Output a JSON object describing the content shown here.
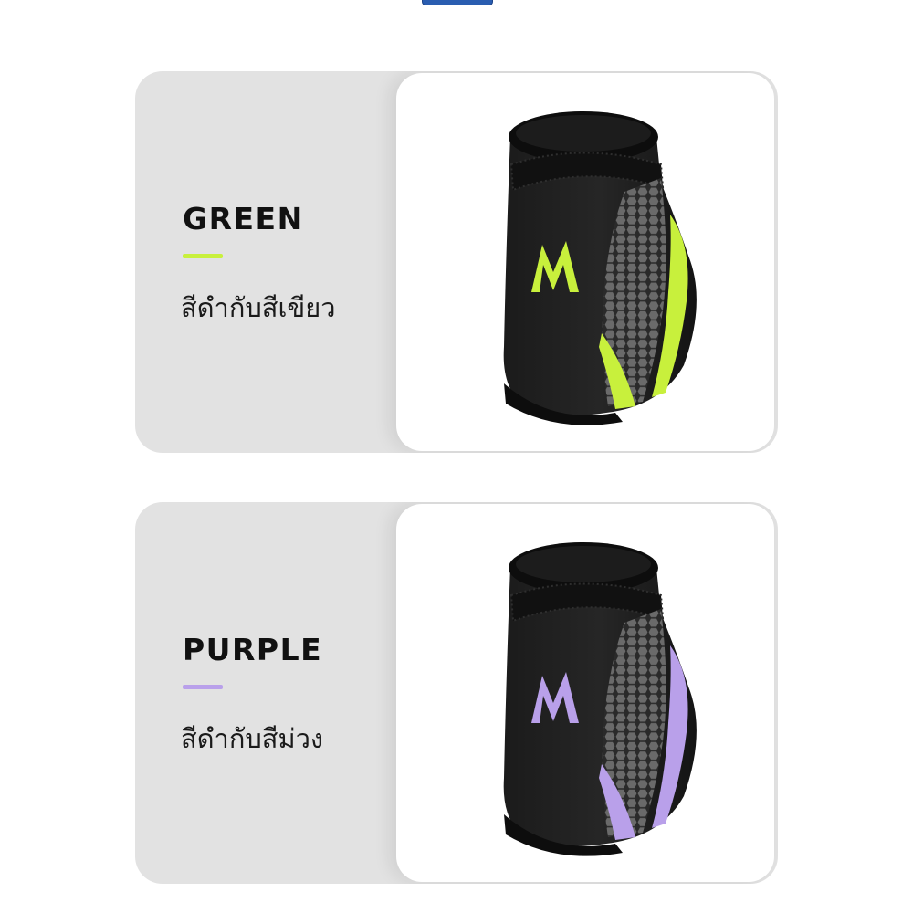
{
  "variants": [
    {
      "name": "GREEN",
      "description": "สีดำกับสีเขียว",
      "accent_color": "#c8f03c",
      "image_label": "black-green-ankle-brace"
    },
    {
      "name": "PURPLE",
      "description": "สีดำกับสีม่วง",
      "accent_color": "#b9a0ea",
      "image_label": "black-purple-ankle-brace"
    }
  ]
}
